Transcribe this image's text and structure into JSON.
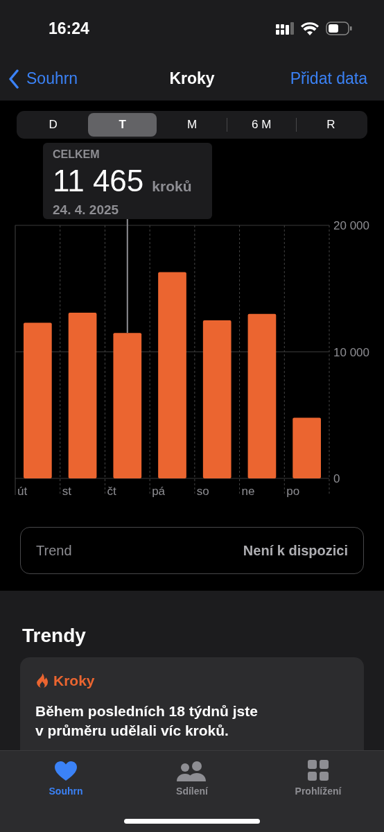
{
  "status_bar": {
    "time": "16:24"
  },
  "nav": {
    "back": "Souhrn",
    "title": "Kroky",
    "action": "Přidat data"
  },
  "segments": [
    {
      "label": "D",
      "selected": false
    },
    {
      "label": "T",
      "selected": true
    },
    {
      "label": "M",
      "selected": false
    },
    {
      "label": "6 M",
      "selected": false
    },
    {
      "label": "R",
      "selected": false
    }
  ],
  "tooltip": {
    "label": "CELKEM",
    "value": "11 465",
    "unit": "kroků",
    "date": "24. 4. 2025"
  },
  "chart_data": {
    "type": "bar",
    "categories": [
      "út",
      "st",
      "čt",
      "pá",
      "so",
      "ne",
      "po"
    ],
    "series": [
      {
        "color": "#eb6530",
        "values": [
          12300,
          13100,
          11500,
          16300,
          12500,
          13000,
          4800
        ]
      }
    ],
    "ylim": [
      0,
      20000
    ],
    "yticks": [
      {
        "value": 0,
        "label": "0"
      },
      {
        "value": 10000,
        "label": "10 000"
      },
      {
        "value": 20000,
        "label": "20 000"
      }
    ],
    "annotations": [
      {
        "x": "čt"
      }
    ]
  },
  "trend": {
    "label": "Trend",
    "value": "Není k dispozici"
  },
  "trends_section": {
    "title": "Trendy",
    "card": {
      "category": "Kroky",
      "text": "Během posledních 18 týdnů jste v průměru udělali víc kroků."
    }
  },
  "tab_bar": [
    {
      "label": "Souhrn",
      "selected": true
    },
    {
      "label": "Sdílení",
      "selected": false
    },
    {
      "label": "Prohlížení",
      "selected": false
    }
  ]
}
